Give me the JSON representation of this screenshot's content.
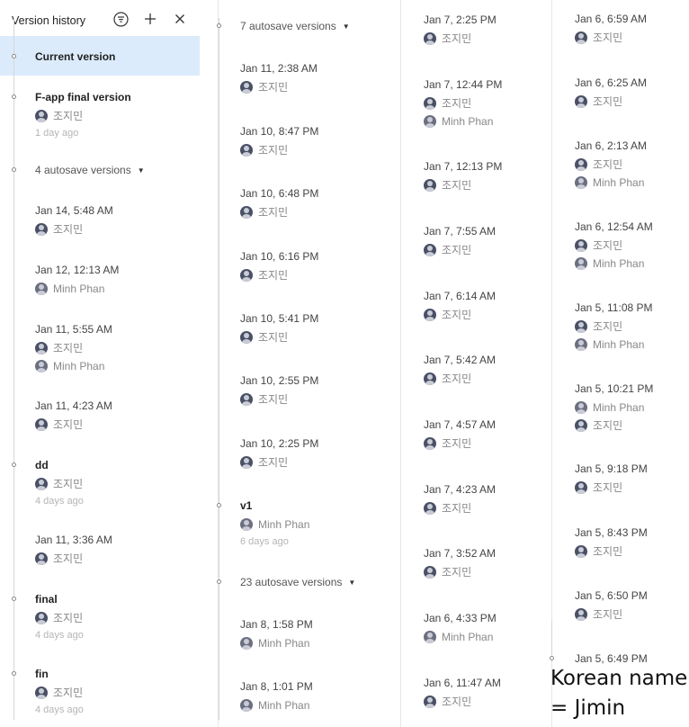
{
  "header": {
    "title": "Version history"
  },
  "current_version": "Current version",
  "users": {
    "jimin": "조지민",
    "minh": "Minh Phan"
  },
  "col1": [
    {
      "kind": "named",
      "title": "F-app final version",
      "users": [
        "jimin"
      ],
      "ago": "1 day ago"
    },
    {
      "kind": "group",
      "title": "4 autosave versions"
    },
    {
      "kind": "date",
      "title": "Jan 14, 5:48 AM",
      "users": [
        "jimin"
      ]
    },
    {
      "kind": "date",
      "title": "Jan 12, 12:13 AM",
      "users": [
        "minh"
      ]
    },
    {
      "kind": "date",
      "title": "Jan 11, 5:55 AM",
      "users": [
        "jimin",
        "minh"
      ]
    },
    {
      "kind": "date",
      "title": "Jan 11, 4:23 AM",
      "users": [
        "jimin"
      ]
    },
    {
      "kind": "named",
      "title": "dd",
      "users": [
        "jimin"
      ],
      "ago": "4 days ago"
    },
    {
      "kind": "date",
      "title": "Jan 11, 3:36 AM",
      "users": [
        "jimin"
      ]
    },
    {
      "kind": "named",
      "title": "final",
      "users": [
        "jimin"
      ],
      "ago": "4 days ago"
    },
    {
      "kind": "named",
      "title": "fin",
      "users": [
        "jimin"
      ],
      "ago": "4 days ago"
    }
  ],
  "col2": [
    {
      "kind": "group",
      "title": "7 autosave versions"
    },
    {
      "kind": "date",
      "title": "Jan 11, 2:38 AM",
      "users": [
        "jimin"
      ]
    },
    {
      "kind": "date",
      "title": "Jan 10, 8:47 PM",
      "users": [
        "jimin"
      ]
    },
    {
      "kind": "date",
      "title": "Jan 10, 6:48 PM",
      "users": [
        "jimin"
      ]
    },
    {
      "kind": "date",
      "title": "Jan 10, 6:16 PM",
      "users": [
        "jimin"
      ]
    },
    {
      "kind": "date",
      "title": "Jan 10, 5:41 PM",
      "users": [
        "jimin"
      ]
    },
    {
      "kind": "date",
      "title": "Jan 10, 2:55 PM",
      "users": [
        "jimin"
      ]
    },
    {
      "kind": "date",
      "title": "Jan 10, 2:25 PM",
      "users": [
        "jimin"
      ]
    },
    {
      "kind": "named",
      "title": "v1",
      "users": [
        "minh"
      ],
      "ago": "6 days ago"
    },
    {
      "kind": "group",
      "title": "23 autosave versions"
    },
    {
      "kind": "date",
      "title": "Jan 8, 1:58 PM",
      "users": [
        "minh"
      ]
    },
    {
      "kind": "date",
      "title": "Jan 8, 1:01 PM",
      "users": [
        "minh"
      ]
    }
  ],
  "col3": [
    {
      "kind": "date",
      "title": "Jan 7, 2:25 PM",
      "users": [
        "jimin"
      ]
    },
    {
      "kind": "date",
      "title": "Jan 7, 12:44 PM",
      "users": [
        "jimin",
        "minh"
      ]
    },
    {
      "kind": "date",
      "title": "Jan 7, 12:13 PM",
      "users": [
        "jimin"
      ]
    },
    {
      "kind": "date",
      "title": "Jan 7, 7:55 AM",
      "users": [
        "jimin"
      ]
    },
    {
      "kind": "date",
      "title": "Jan 7, 6:14 AM",
      "users": [
        "jimin"
      ]
    },
    {
      "kind": "date",
      "title": "Jan 7, 5:42 AM",
      "users": [
        "jimin"
      ]
    },
    {
      "kind": "date",
      "title": "Jan 7, 4:57 AM",
      "users": [
        "jimin"
      ]
    },
    {
      "kind": "date",
      "title": "Jan 7, 4:23 AM",
      "users": [
        "jimin"
      ]
    },
    {
      "kind": "date",
      "title": "Jan 7, 3:52 AM",
      "users": [
        "jimin"
      ]
    },
    {
      "kind": "date",
      "title": "Jan 6, 4:33 PM",
      "users": [
        "minh"
      ]
    },
    {
      "kind": "date",
      "title": "Jan 6, 11:47 AM",
      "users": [
        "jimin"
      ]
    }
  ],
  "col4": [
    {
      "kind": "date",
      "title": "Jan 6, 6:59 AM",
      "users": [
        "jimin"
      ]
    },
    {
      "kind": "date",
      "title": "Jan 6, 6:25 AM",
      "users": [
        "jimin"
      ]
    },
    {
      "kind": "date",
      "title": "Jan 6, 2:13 AM",
      "users": [
        "jimin",
        "minh"
      ]
    },
    {
      "kind": "date",
      "title": "Jan 6, 12:54 AM",
      "users": [
        "jimin",
        "minh"
      ]
    },
    {
      "kind": "date",
      "title": "Jan 5, 11:08 PM",
      "users": [
        "jimin",
        "minh"
      ]
    },
    {
      "kind": "date",
      "title": "Jan 5, 10:21 PM",
      "users": [
        "minh",
        "jimin"
      ]
    },
    {
      "kind": "date",
      "title": "Jan 5, 9:18 PM",
      "users": [
        "jimin"
      ]
    },
    {
      "kind": "date",
      "title": "Jan 5, 8:43 PM",
      "users": [
        "jimin"
      ]
    },
    {
      "kind": "date",
      "title": "Jan 5, 6:50 PM",
      "users": [
        "jimin"
      ]
    },
    {
      "kind": "date",
      "title": "Jan 5, 6:49 PM",
      "users": []
    }
  ],
  "note": {
    "line1": "Korean name",
    "line2": "= Jimin"
  }
}
